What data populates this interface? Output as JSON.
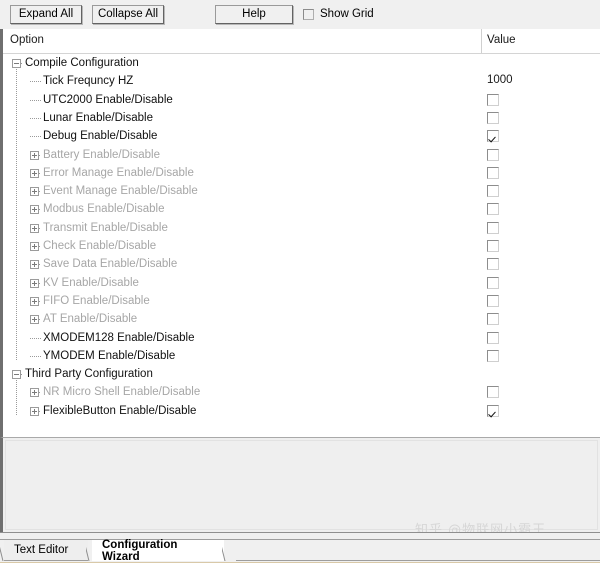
{
  "toolbar": {
    "expand_all": "Expand All",
    "collapse_all": "Collapse All",
    "help": "Help",
    "show_grid": "Show Grid",
    "show_grid_checked": false
  },
  "grid": {
    "columns": {
      "option": "Option",
      "value": "Value"
    },
    "rows": [
      {
        "label": "Compile Configuration",
        "depth": 0,
        "toggle": "minus",
        "enabled": true,
        "value_type": "none"
      },
      {
        "label": "Tick Frequncy HZ",
        "depth": 1,
        "toggle": "leaf",
        "enabled": true,
        "value_type": "text",
        "value": "1000"
      },
      {
        "label": "UTC2000 Enable/Disable",
        "depth": 1,
        "toggle": "leaf",
        "enabled": true,
        "value_type": "checkbox",
        "checked": false
      },
      {
        "label": "Lunar Enable/Disable",
        "depth": 1,
        "toggle": "leaf",
        "enabled": true,
        "value_type": "checkbox",
        "checked": false
      },
      {
        "label": "Debug Enable/Disable",
        "depth": 1,
        "toggle": "leaf",
        "enabled": true,
        "value_type": "checkbox",
        "checked": true
      },
      {
        "label": "Battery Enable/Disable",
        "depth": 1,
        "toggle": "plus",
        "enabled": false,
        "value_type": "checkbox",
        "checked": false
      },
      {
        "label": "Error Manage Enable/Disable",
        "depth": 1,
        "toggle": "plus",
        "enabled": false,
        "value_type": "checkbox",
        "checked": false
      },
      {
        "label": "Event Manage Enable/Disable",
        "depth": 1,
        "toggle": "plus",
        "enabled": false,
        "value_type": "checkbox",
        "checked": false
      },
      {
        "label": "Modbus Enable/Disable",
        "depth": 1,
        "toggle": "plus",
        "enabled": false,
        "value_type": "checkbox",
        "checked": false
      },
      {
        "label": "Transmit Enable/Disable",
        "depth": 1,
        "toggle": "plus",
        "enabled": false,
        "value_type": "checkbox",
        "checked": false
      },
      {
        "label": "Check Enable/Disable",
        "depth": 1,
        "toggle": "plus",
        "enabled": false,
        "value_type": "checkbox",
        "checked": false
      },
      {
        "label": "Save Data Enable/Disable",
        "depth": 1,
        "toggle": "plus",
        "enabled": false,
        "value_type": "checkbox",
        "checked": false
      },
      {
        "label": "KV Enable/Disable",
        "depth": 1,
        "toggle": "plus",
        "enabled": false,
        "value_type": "checkbox",
        "checked": false
      },
      {
        "label": "FIFO Enable/Disable",
        "depth": 1,
        "toggle": "plus",
        "enabled": false,
        "value_type": "checkbox",
        "checked": false
      },
      {
        "label": "AT Enable/Disable",
        "depth": 1,
        "toggle": "plus",
        "enabled": false,
        "value_type": "checkbox",
        "checked": false
      },
      {
        "label": "XMODEM128 Enable/Disable",
        "depth": 1,
        "toggle": "leaf",
        "enabled": true,
        "value_type": "checkbox",
        "checked": false
      },
      {
        "label": "YMODEM Enable/Disable",
        "depth": 1,
        "toggle": "leaf",
        "enabled": true,
        "value_type": "checkbox",
        "checked": false
      },
      {
        "label": "Third Party Configuration",
        "depth": 0,
        "toggle": "minus",
        "enabled": true,
        "value_type": "none"
      },
      {
        "label": "NR Micro Shell Enable/Disable",
        "depth": 1,
        "toggle": "plus",
        "enabled": false,
        "value_type": "checkbox",
        "checked": false
      },
      {
        "label": "FlexibleButton Enable/Disable",
        "depth": 1,
        "toggle": "plus",
        "enabled": true,
        "value_type": "checkbox",
        "checked": true
      }
    ]
  },
  "description_pane": {
    "text": ""
  },
  "watermark": {
    "text": "知乎 @物联网小霸王"
  },
  "tabs": [
    {
      "label": "Text Editor",
      "active": false
    },
    {
      "label": "Configuration Wizard",
      "active": true
    }
  ]
}
